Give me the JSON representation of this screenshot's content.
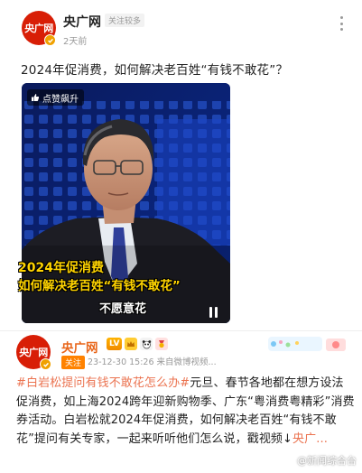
{
  "post1": {
    "avatar_text": "央广网",
    "account_name": "央广网",
    "follow_tag": "关注较多",
    "time": "2天前",
    "title": "2024年促消费，如何解决老百姓“有钱不敢花”？",
    "video": {
      "badge": "点赞飙升",
      "caption_line1": "2024年促消费",
      "caption_line2": "如何解决老百姓“有钱不敢花”",
      "caption_line3": "不愿意花"
    }
  },
  "post2": {
    "avatar_text": "央广网",
    "account_name": "央广网",
    "level": "LV",
    "follow_label": "关注",
    "meta": "23-12-30 15:26  来自微博视频...",
    "topic": "#白岩松提问有钱不敢花怎么办#",
    "body": "元旦、春节各地都在想方设法促消费，如上海2024跨年迎新购物季、广东“粤消费粤精彩”消费券活动。白岩松就2024年促消费，如何解决老百姓“有钱不敢花”提问有关专家，一起来听听他们怎么说，戳视频↓",
    "link_tail": "央广...",
    "watermark": "@新闻综合台"
  }
}
